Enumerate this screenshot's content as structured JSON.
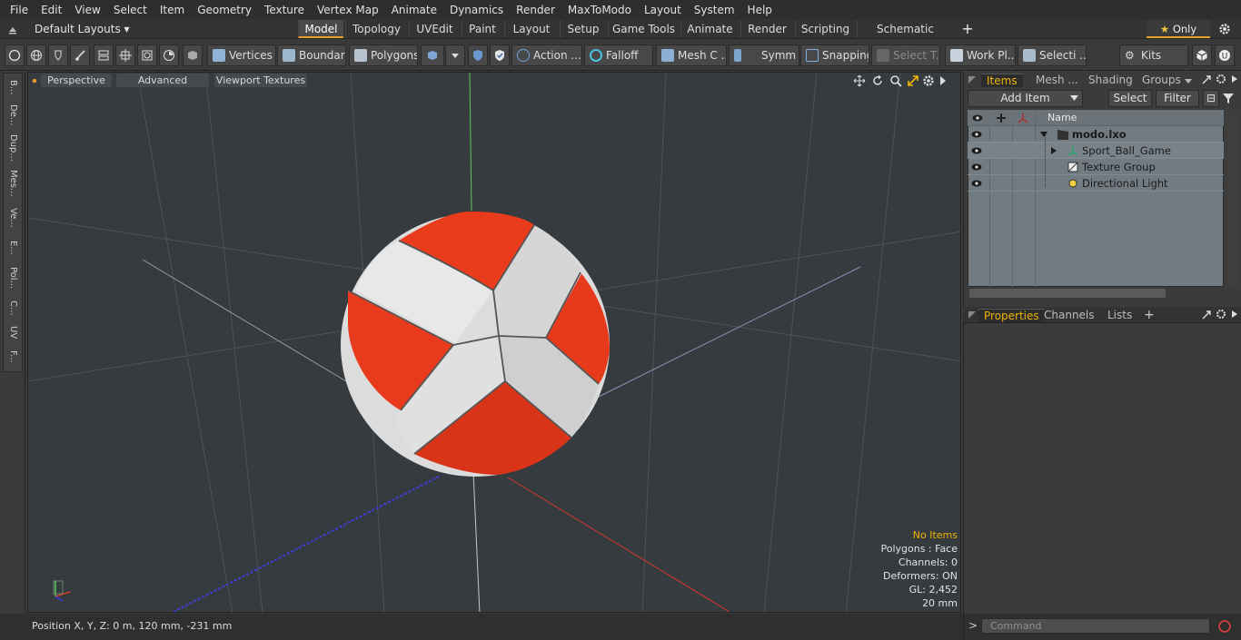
{
  "menu": [
    "File",
    "Edit",
    "View",
    "Select",
    "Item",
    "Geometry",
    "Texture",
    "Vertex Map",
    "Animate",
    "Dynamics",
    "Render",
    "MaxToModo",
    "Layout",
    "System",
    "Help"
  ],
  "layout_dropdown": "Default Layouts",
  "mode_tabs": [
    "Model",
    "Topology",
    "UVEdit",
    "Paint",
    "Layout",
    "Setup",
    "Game Tools",
    "Animate",
    "Render",
    "Scripting",
    "Schematic Fusion"
  ],
  "only_label": "Only",
  "toolbar": {
    "vertices": "Vertices",
    "boundary": "Boundary",
    "polygons": "Polygons",
    "action": "Action ...",
    "falloff": "Falloff",
    "mesh_c": "Mesh C ...",
    "symm": "Symm ...",
    "snapping": "Snapping",
    "select_t": "Select T...",
    "work_pl": "Work Pl...",
    "selecti": "Selecti ...",
    "kits": "Kits"
  },
  "left_tabs": [
    "B...",
    "De...",
    "Dup...",
    "Mes...",
    "Ve...",
    "E...",
    "Pol...",
    "C...",
    "UV",
    "F..."
  ],
  "viewport": {
    "perspective": "Perspective",
    "advanced": "Advanced",
    "viewport_textures": "Viewport Textures",
    "info": {
      "no_items": "No Items",
      "polygons": "Polygons : Face",
      "channels": "Channels: 0",
      "deformers": "Deformers: ON",
      "gl": "GL: 2,452",
      "scale": "20 mm"
    }
  },
  "status": "Position X, Y, Z:   0 m, 120 mm, -231 mm",
  "right_panel": {
    "tabs": [
      "Items",
      "Mesh ...",
      "Shading",
      "Groups"
    ],
    "add_item": "Add Item",
    "select": "Select",
    "filter": "Filter",
    "column_name": "Name",
    "items": [
      "modo.lxo",
      "Sport_Ball_Game",
      "Texture Group",
      "Directional Light"
    ],
    "props_tabs": [
      "Properties",
      "Channels",
      "Lists"
    ],
    "command_placeholder": "Command"
  },
  "colors": {
    "accent": "#e6a12a",
    "ball_red": "#e8391f",
    "ball_white": "#e2e2e2",
    "viewport_bg": "#363b40"
  }
}
